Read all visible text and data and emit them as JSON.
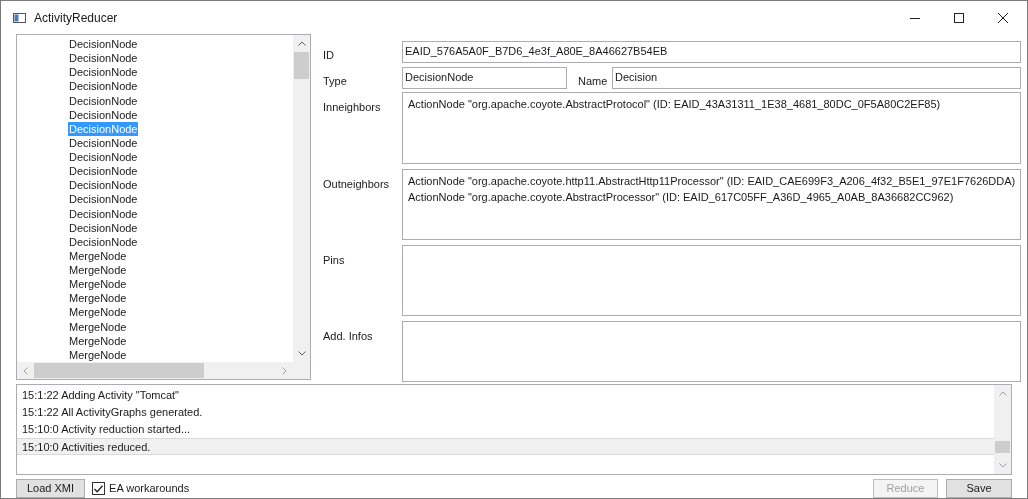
{
  "window": {
    "title": "ActivityReducer"
  },
  "node_list": {
    "items": [
      {
        "label": "DecisionNode",
        "selected": false
      },
      {
        "label": "DecisionNode",
        "selected": false
      },
      {
        "label": "DecisionNode",
        "selected": false
      },
      {
        "label": "DecisionNode",
        "selected": false
      },
      {
        "label": "DecisionNode",
        "selected": false
      },
      {
        "label": "DecisionNode",
        "selected": false
      },
      {
        "label": "DecisionNode",
        "selected": true
      },
      {
        "label": "DecisionNode",
        "selected": false
      },
      {
        "label": "DecisionNode",
        "selected": false
      },
      {
        "label": "DecisionNode",
        "selected": false
      },
      {
        "label": "DecisionNode",
        "selected": false
      },
      {
        "label": "DecisionNode",
        "selected": false
      },
      {
        "label": "DecisionNode",
        "selected": false
      },
      {
        "label": "DecisionNode",
        "selected": false
      },
      {
        "label": "DecisionNode",
        "selected": false
      },
      {
        "label": "MergeNode",
        "selected": false
      },
      {
        "label": "MergeNode",
        "selected": false
      },
      {
        "label": "MergeNode",
        "selected": false
      },
      {
        "label": "MergeNode",
        "selected": false
      },
      {
        "label": "MergeNode",
        "selected": false
      },
      {
        "label": "MergeNode",
        "selected": false
      },
      {
        "label": "MergeNode",
        "selected": false
      },
      {
        "label": "MergeNode",
        "selected": false
      }
    ]
  },
  "details": {
    "id": {
      "label": "ID",
      "value": "EAID_576A5A0F_B7D6_4e3f_A80E_8A46627B54EB"
    },
    "type": {
      "label": "Type",
      "value": "DecisionNode"
    },
    "name": {
      "label": "Name",
      "value": "Decision"
    },
    "inneighbors": {
      "label": "Inneighbors",
      "lines": [
        "ActionNode \"org.apache.coyote.AbstractProtocol\" (ID: EAID_43A31311_1E38_4681_80DC_0F5A80C2EF85)"
      ]
    },
    "outneighbors": {
      "label": "Outneighbors",
      "lines": [
        "ActionNode \"org.apache.coyote.http11.AbstractHttp11Processor\" (ID: EAID_CAE699F3_A206_4f32_B5E1_97E1F7626DDA)",
        "ActionNode \"org.apache.coyote.AbstractProcessor\" (ID: EAID_617C05FF_A36D_4965_A0AB_8A36682CC962)"
      ]
    },
    "pins": {
      "label": "Pins"
    },
    "add_infos": {
      "label": "Add. Infos"
    }
  },
  "log": {
    "entries": [
      {
        "text": "15:1:22 Adding Activity \"Tomcat\"",
        "selected": false
      },
      {
        "text": "15:1:22 All ActivityGraphs generated.",
        "selected": false
      },
      {
        "text": "15:10:0 Activity reduction started...",
        "selected": false
      },
      {
        "text": "15:10:0 Activities reduced.",
        "selected": true
      }
    ]
  },
  "footer": {
    "load_button": "Load XMI",
    "ea_workarounds": {
      "label": "EA workarounds",
      "checked": true
    },
    "reduce_button": {
      "label": "Reduce",
      "disabled": true
    },
    "save_button": "Save"
  }
}
